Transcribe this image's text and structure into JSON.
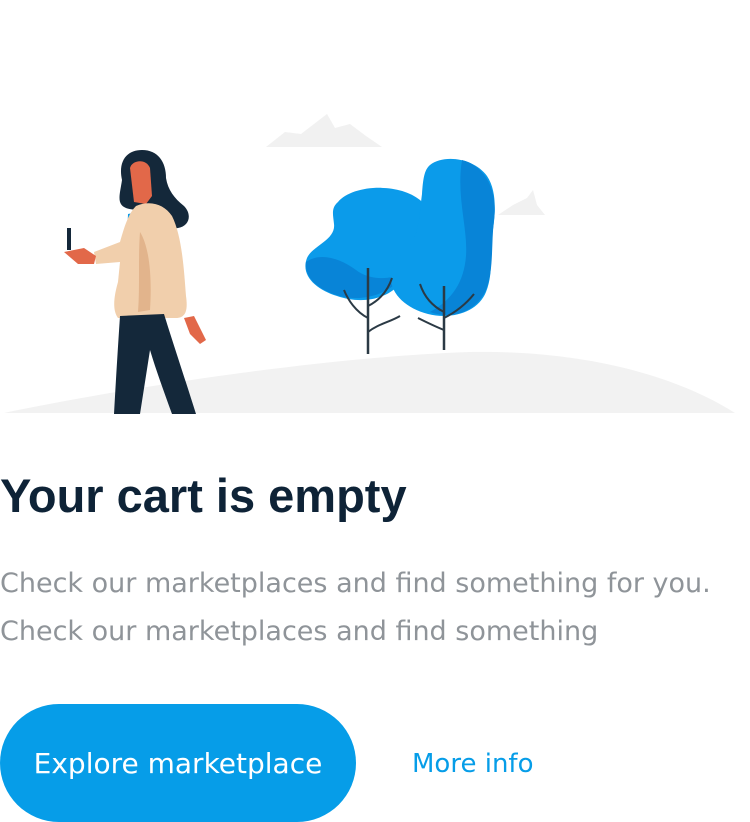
{
  "colors": {
    "accent": "#069de8",
    "title": "#0e2337",
    "description": "#8f9499"
  },
  "empty_state": {
    "title": "Your cart is empty",
    "description": "Check our marketplaces and find something for you. Check our marketplaces and find something",
    "primary_button_label": "Explore marketplace",
    "secondary_button_label": "More info"
  }
}
